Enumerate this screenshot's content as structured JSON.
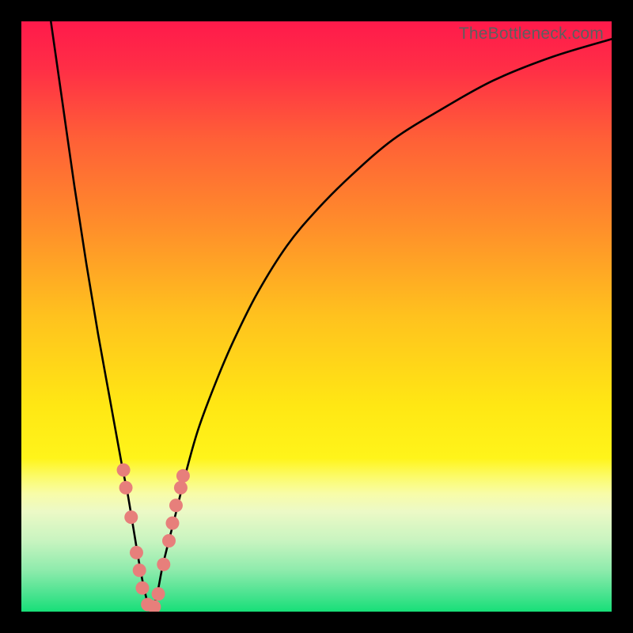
{
  "watermark": "TheBottleneck.com",
  "colors": {
    "black": "#000000",
    "curve": "#000000",
    "marker_fill": "#e77f7b",
    "marker_stroke": "#d86964",
    "gradient_stops": [
      {
        "offset": 0.0,
        "color": "#ff1a4b"
      },
      {
        "offset": 0.08,
        "color": "#ff2e46"
      },
      {
        "offset": 0.2,
        "color": "#ff6037"
      },
      {
        "offset": 0.35,
        "color": "#ff8f2a"
      },
      {
        "offset": 0.5,
        "color": "#ffc21e"
      },
      {
        "offset": 0.65,
        "color": "#ffe714"
      },
      {
        "offset": 0.74,
        "color": "#fff41a"
      },
      {
        "offset": 0.77,
        "color": "#fcfb66"
      },
      {
        "offset": 0.8,
        "color": "#f8fca8"
      },
      {
        "offset": 0.83,
        "color": "#ecf9c6"
      },
      {
        "offset": 0.88,
        "color": "#c8f4c0"
      },
      {
        "offset": 0.93,
        "color": "#8eebac"
      },
      {
        "offset": 0.97,
        "color": "#4be390"
      },
      {
        "offset": 1.0,
        "color": "#17df78"
      }
    ]
  },
  "chart_data": {
    "type": "line",
    "title": "",
    "xlabel": "",
    "ylabel": "",
    "xlim": [
      0,
      100
    ],
    "ylim": [
      0,
      100
    ],
    "series": [
      {
        "name": "bottleneck-curve",
        "x": [
          5,
          7,
          9,
          11,
          13,
          15,
          17,
          18,
          19,
          20,
          21,
          22,
          23,
          24,
          26,
          28,
          30,
          33,
          36,
          40,
          45,
          50,
          56,
          63,
          71,
          80,
          90,
          100
        ],
        "y": [
          100,
          86,
          72,
          59,
          47,
          36,
          25,
          20,
          14,
          8,
          3,
          0,
          3,
          8,
          16,
          24,
          31,
          39,
          46,
          54,
          62,
          68,
          74,
          80,
          85,
          90,
          94,
          97
        ]
      }
    ],
    "markers": {
      "name": "highlighted-points",
      "points": [
        {
          "x": 17.3,
          "y": 24.0
        },
        {
          "x": 17.7,
          "y": 21.0
        },
        {
          "x": 18.6,
          "y": 16.0
        },
        {
          "x": 19.5,
          "y": 10.0
        },
        {
          "x": 20.0,
          "y": 7.0
        },
        {
          "x": 20.5,
          "y": 4.0
        },
        {
          "x": 21.4,
          "y": 1.2
        },
        {
          "x": 22.5,
          "y": 0.8
        },
        {
          "x": 23.2,
          "y": 3.0
        },
        {
          "x": 24.1,
          "y": 8.0
        },
        {
          "x": 25.0,
          "y": 12.0
        },
        {
          "x": 25.6,
          "y": 15.0
        },
        {
          "x": 26.2,
          "y": 18.0
        },
        {
          "x": 27.0,
          "y": 21.0
        },
        {
          "x": 27.4,
          "y": 23.0
        }
      ],
      "radius": 8.5
    }
  }
}
